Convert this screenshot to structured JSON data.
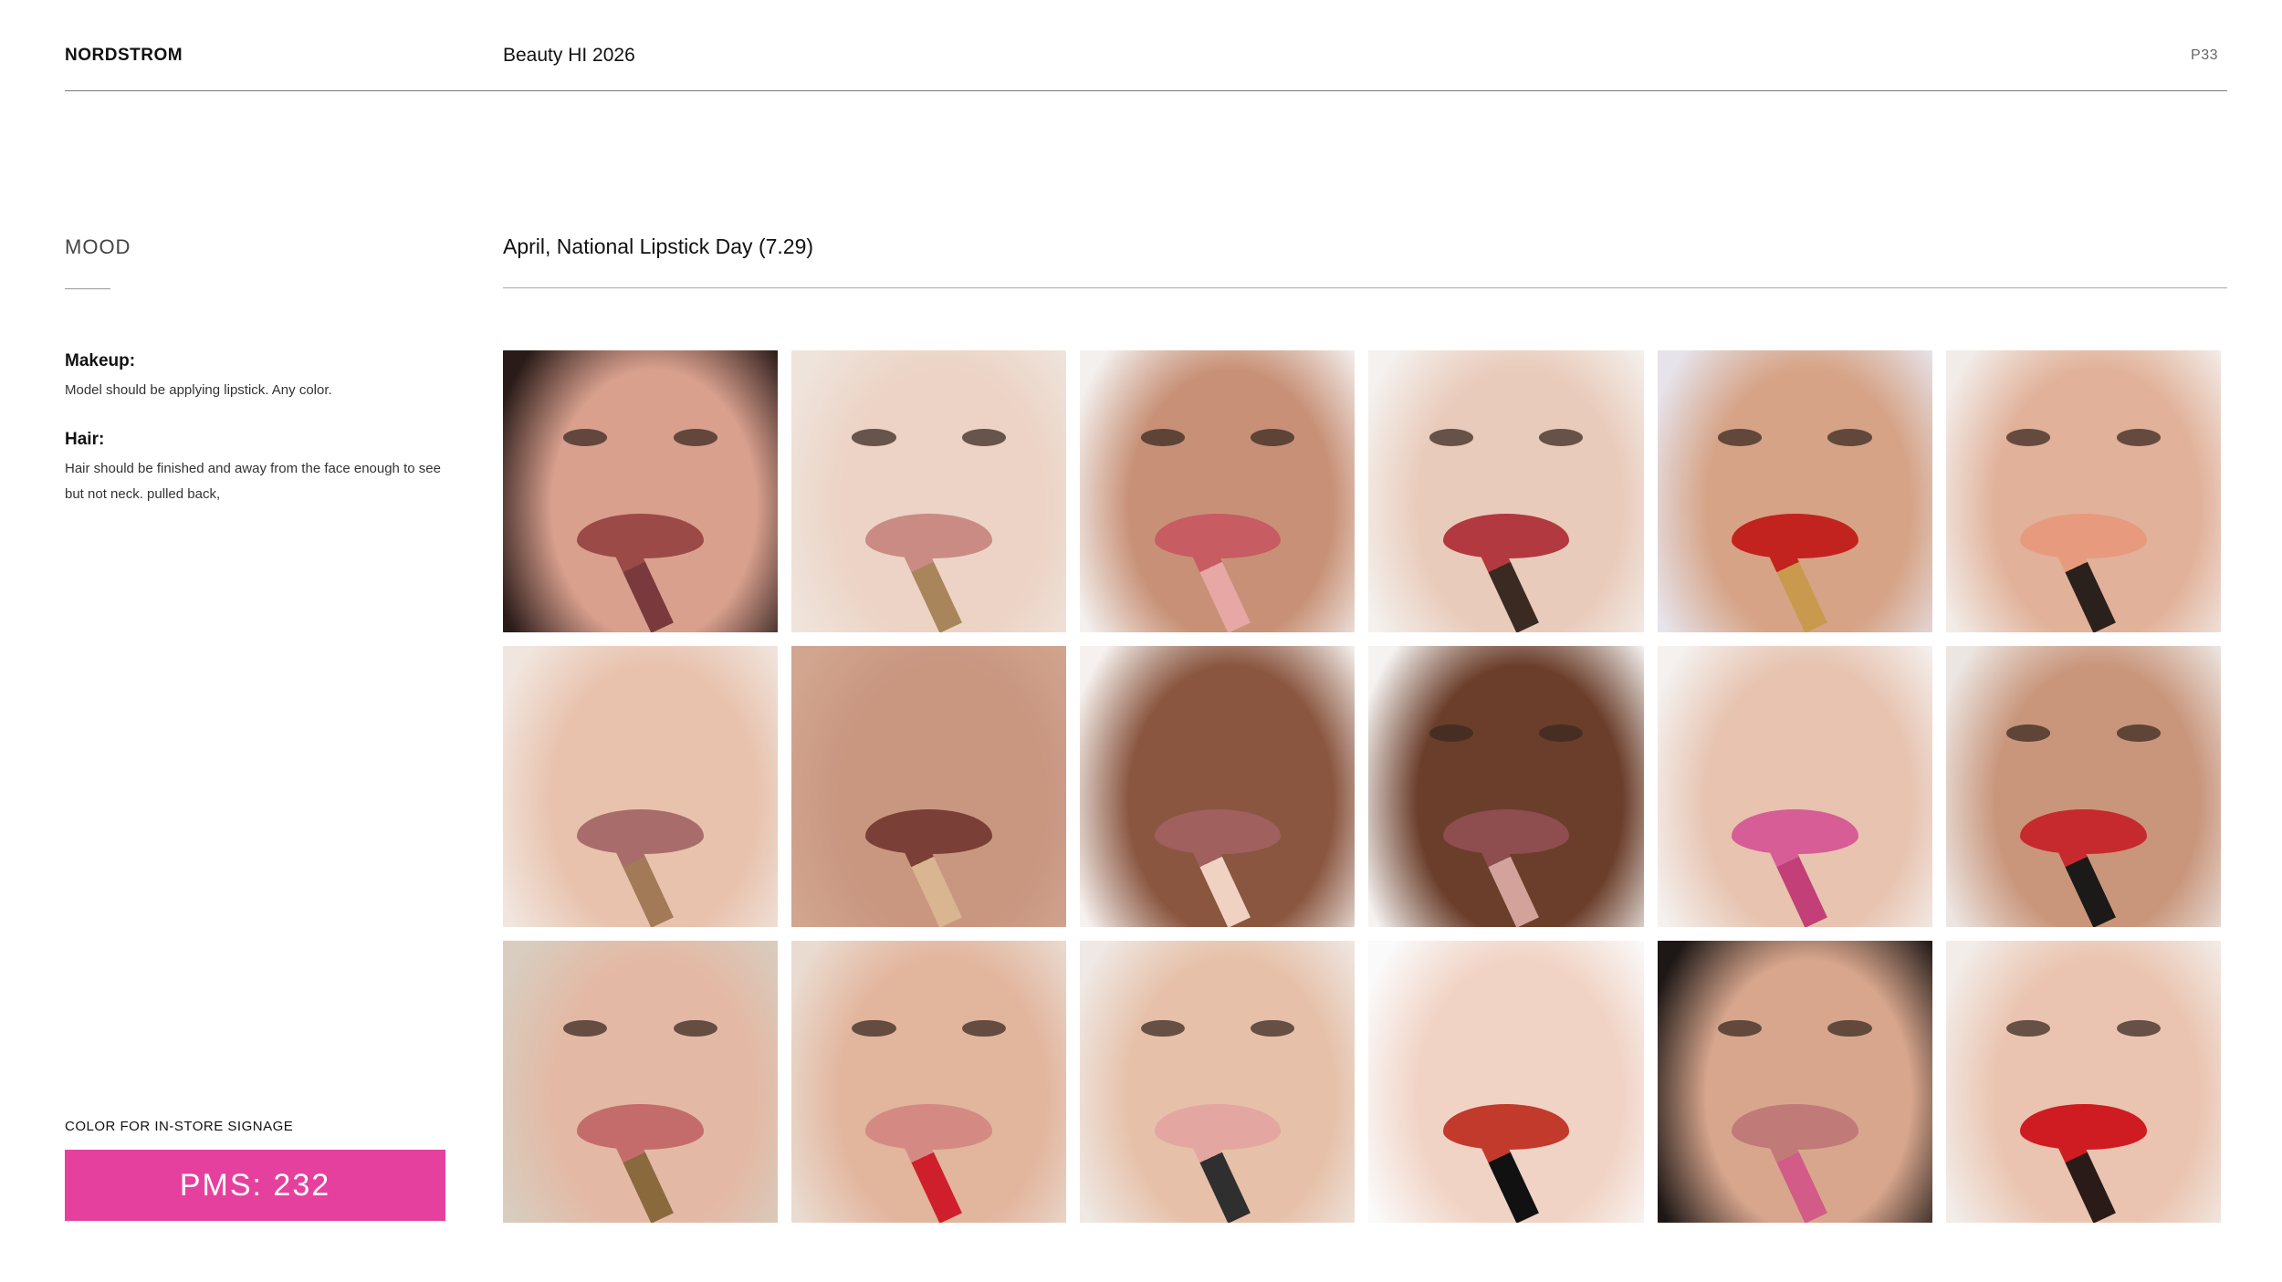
{
  "header": {
    "brand": "NORDSTROM",
    "doc_title": "Beauty HI 2026",
    "page_number": "P33"
  },
  "sidebar": {
    "section_label": "MOOD",
    "notes": [
      {
        "heading": "Makeup:",
        "text": "Model should be applying lipstick. Any color."
      },
      {
        "heading": "Hair:",
        "text": "Hair should be finished and away from the face enough to see but not neck. pulled back,"
      }
    ],
    "signage_label": "COLOR FOR IN-STORE SIGNAGE",
    "pms_label": "PMS: 232",
    "pms_color": "#e6409e"
  },
  "main": {
    "section_title": "April, National Lipstick Day (7.29)",
    "photos": [
      {
        "bg": "#2a1a18",
        "skin": "#d9a08e",
        "lip": "#9b4a47",
        "stick": "#7a3a3d",
        "eyes": true
      },
      {
        "bg": "#efe4dc",
        "skin": "#ecd3c5",
        "lip": "#c98b83",
        "stick": "#a8855a",
        "eyes": true
      },
      {
        "bg": "#f3f0ee",
        "skin": "#c89177",
        "lip": "#c75c63",
        "stick": "#e6a7a5",
        "eyes": true
      },
      {
        "bg": "#f4f1ee",
        "skin": "#e9cbbb",
        "lip": "#b2393f",
        "stick": "#3a2a22",
        "eyes": true
      },
      {
        "bg": "#e6e3ea",
        "skin": "#d6a386",
        "lip": "#c2231f",
        "stick": "#c99a4e",
        "eyes": true
      },
      {
        "bg": "#f2ece8",
        "skin": "#e1b199",
        "lip": "#e89a7f",
        "stick": "#2b211c",
        "eyes": true
      },
      {
        "bg": "#f1e6df",
        "skin": "#e8c2ad",
        "lip": "#a86d6a",
        "stick": "#a27a58",
        "eyes": false
      },
      {
        "bg": "#d1a58f",
        "skin": "#c99680",
        "lip": "#7a3f37",
        "stick": "#d9b592",
        "eyes": false
      },
      {
        "bg": "#f6f1ee",
        "skin": "#8a5640",
        "lip": "#a0605e",
        "stick": "#f0d2c3",
        "eyes": false
      },
      {
        "bg": "#f5f3f1",
        "skin": "#6b3e2b",
        "lip": "#8e4d4e",
        "stick": "#d3a29b",
        "eyes": true
      },
      {
        "bg": "#f4f1ef",
        "skin": "#e7c3b0",
        "lip": "#d65d95",
        "stick": "#c24077",
        "eyes": false
      },
      {
        "bg": "#ece6e2",
        "skin": "#c9967c",
        "lip": "#c72a2e",
        "stick": "#1b1a19",
        "eyes": true
      },
      {
        "bg": "#d8cdbf",
        "skin": "#e3b9a5",
        "lip": "#c46c6c",
        "stick": "#8a6a3c",
        "eyes": true
      },
      {
        "bg": "#eadbd0",
        "skin": "#e2b59d",
        "lip": "#d48a83",
        "stick": "#cf1f2c",
        "eyes": true
      },
      {
        "bg": "#efe8e4",
        "skin": "#e6c0a8",
        "lip": "#e4a6a0",
        "stick": "#2f2f30",
        "eyes": true
      },
      {
        "bg": "#fafafa",
        "skin": "#f1d3c5",
        "lip": "#c23a2c",
        "stick": "#111111",
        "eyes": false
      },
      {
        "bg": "#1d1715",
        "skin": "#d8a68d",
        "lip": "#c07b78",
        "stick": "#d25b88",
        "eyes": true
      },
      {
        "bg": "#f2ede9",
        "skin": "#eac4b0",
        "lip": "#cf1b22",
        "stick": "#2a1b18",
        "eyes": true
      }
    ]
  }
}
